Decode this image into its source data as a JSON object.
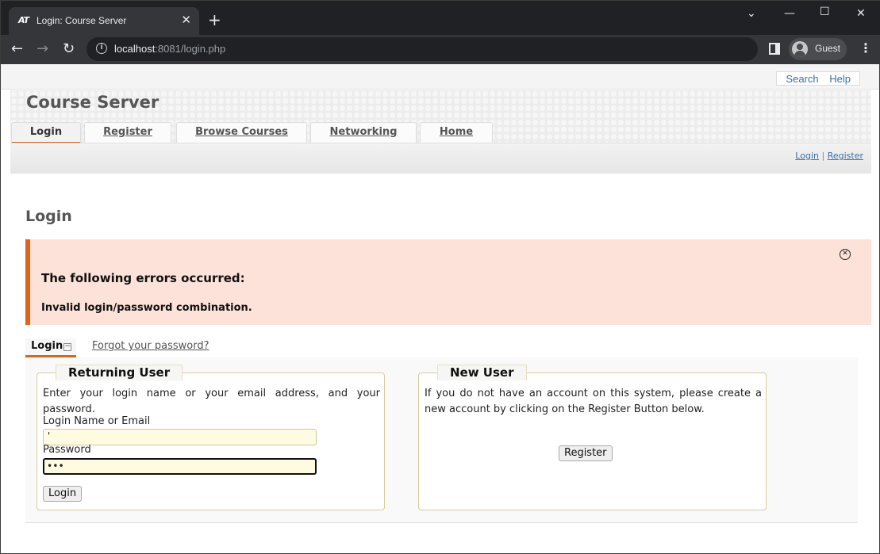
{
  "browser": {
    "tab_title": "Login: Course Server",
    "tab_favicon": "AT",
    "url_host": "localhost",
    "url_rest": ":8081/login.php",
    "profile_label": "Guest"
  },
  "topnav": {
    "search": "Search",
    "help": "Help"
  },
  "site": {
    "title": "Course Server",
    "tabs": [
      {
        "label": "Login",
        "active": true
      },
      {
        "label": "Register",
        "active": false
      },
      {
        "label": "Browse Courses",
        "active": false
      },
      {
        "label": "Networking",
        "active": false
      },
      {
        "label": "Home",
        "active": false
      }
    ],
    "subnav": {
      "login": "Login",
      "sep": "|",
      "register": "Register"
    }
  },
  "page_heading": "Login",
  "error": {
    "title": "The following errors occurred:",
    "message": "Invalid login/password combination."
  },
  "login_tabs": {
    "login": "Login",
    "forgot": "Forgot your password?"
  },
  "returning_user": {
    "legend": "Returning User",
    "intro": "Enter your login name or your email address, and your password.",
    "login_label": "Login Name or Email",
    "login_value": "'",
    "password_label": "Password",
    "password_value": "•••",
    "submit": "Login"
  },
  "new_user": {
    "legend": "New User",
    "intro": "If you do not have an account on this system, please create a new account by clicking on the Register Button below.",
    "button": "Register"
  }
}
